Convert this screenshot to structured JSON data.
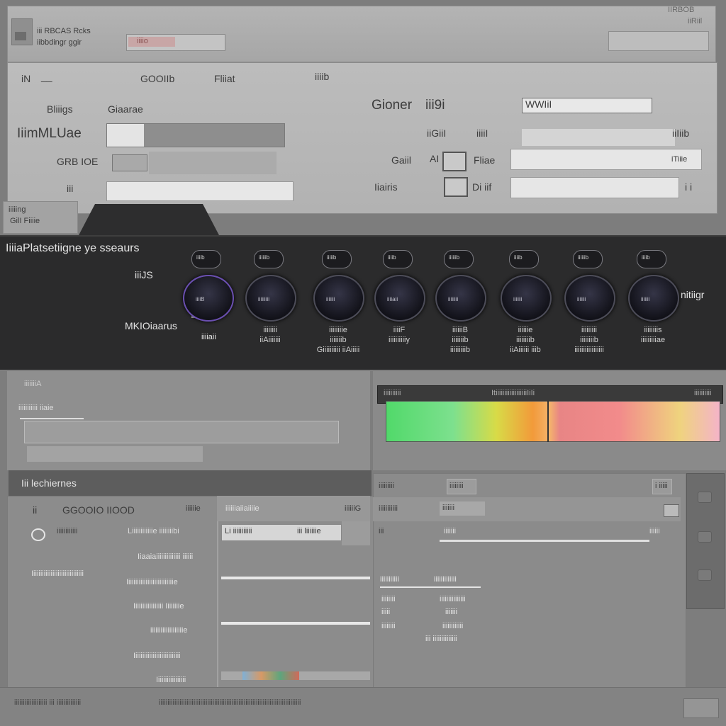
{
  "header": {
    "title_line1": "iii RBCAS Rcks",
    "title_line2": "iibbdingr ggir",
    "field_text": "iiiio",
    "right_title_1": "IIRBOB",
    "right_title_2": "iiRiil"
  },
  "form": {
    "col1_top": "iN",
    "col1_dash": "__",
    "tab_a": "GOOIIb",
    "tab_b": "Fliiat",
    "tab_c": "iiiib",
    "sub_a": "Bliiigs",
    "sub_b": "Giaarae",
    "field1_label": "IiimMLUae",
    "field2_label": "GRB IOE",
    "field3_label": "iii",
    "right_label_1": "Gioner",
    "right_label_1b": "iii9i",
    "right_field_text": "WWIiI",
    "right_row2_a": "iiGiiI",
    "right_row2_b": "iiiiI",
    "right_row2_c": "iiIiib",
    "right_row3_label": "Gaiil",
    "right_row3_mid": "AI",
    "right_row3_c": "Fliae",
    "right_row3_val": "iTiiie",
    "right_row4_label": "Iiairis",
    "right_row4_c": "Di iif",
    "right_row4_val": "i i"
  },
  "corner_tab": {
    "line1": "iiiiing",
    "line2": "GilI Fiiiie"
  },
  "dark": {
    "title": "IiiiaPlatsetiigne ye sseaurs",
    "left_num": "iiiJS",
    "left_label": "MKIOiaarus",
    "left_label_sub": "iiiiaii",
    "right_label": "nitiigr",
    "pills": [
      "iiiib",
      "iiiiiib",
      "iiiiib",
      "iiiib",
      "iiiiiib",
      "iiiib",
      "iiiiiib",
      "iiiib"
    ],
    "dial_caps": [
      "iiiiB",
      "iiiiiiiii",
      "iiiiiii",
      "iiiiaii",
      "iiiiiiii",
      "iiiiiii",
      "iiiiiii",
      "iiiiiii"
    ],
    "labels1": [
      "",
      "iiiiiiii",
      "iiiiiiiie",
      "iiiiF",
      "iiiiiiB",
      "iiiiiie",
      "iiiiiiiii",
      "iiiiiiiis"
    ],
    "labels2": [
      "",
      "iiAiiiiiii",
      "iiiiiiib",
      "iiiiiiiiiiy",
      "iiiiiiib",
      "iiiiiiiib",
      "iiiiiiiib",
      "iiiiiiiiiae"
    ],
    "labels3": [
      "",
      "",
      "Giiiiiiiiii iiAiiiii",
      "",
      "iiiiiiiiib",
      "iiAiiiiii iiib",
      "iiiiiiiiiiiiiiiii",
      ""
    ]
  },
  "lower": {
    "left_title": "iiiiiiiA",
    "left_sub": "iiiiiiiiiii iiaie",
    "right_head_left": "iiiiiiiiii",
    "right_head_mid": "ItiiiiiiiiiiiiiiiiiiIiIi",
    "right_head_right": "iiiiiiiiii"
  },
  "section": {
    "title": "Iii lechiernes"
  },
  "table": {
    "header_a": "GGOOIO IIOOD",
    "header_b": "iiiiiie",
    "header_c": "iiiiiiaiiaiiiie",
    "header_d": "iiiiiiG",
    "row1_a": "iiiiiiiiiiii",
    "row1_b": "Liiiiiiiiiiiie iiiiiiiibi",
    "row1_c": "Li iiiiiiiiiii",
    "row1_d": "iii liiiiiie",
    "left_labels": [
      "Iiiiiiiiiiiiiiiiiiiiiiiiiiiiii"
    ],
    "rows": [
      "Iiaaiaiiiiiiiiiiiiii iiiiii",
      "Iiiiiiiiiiiiiiiiiiiiiiiiiiie",
      "Iiiiiiiiiiiiiiiii Iiiiiiiie",
      "iiiiiiiiiiiiiiiiiiie",
      "Iiiiiiiiiiiiiiiiiiiiiiiiiii",
      "Iiiiiiiiiiiiiiiii"
    ]
  },
  "right_panel": {
    "row1_label": "iiiiiiiii",
    "row1_val": "iiiiiiii",
    "row1_right": "i iiiii",
    "row2_label": "iiiiiiiiiii",
    "row2_val": "iiiiiii",
    "row3_label": "iii",
    "row3_val": "iiiiiii",
    "row3_right": "iiiiii",
    "summary_head_a": "iiiiiiiiiii",
    "summary_head_b": "iiiiiiiiiiiii",
    "summary_rows": [
      [
        "iiiiiiii",
        "iiiiiiiiiiiiiii"
      ],
      [
        "iiiii",
        "iiiiiii"
      ],
      [
        "iiiiiiii",
        "iiiiiiiiiiii"
      ],
      [
        "",
        "iii iiiiiiiiiiiiii"
      ]
    ]
  },
  "footer": {
    "left": "iiiiiiiiiiiiiiiiiii iii iiiiiiiiiiiiii",
    "mid": "iiiiiiiiiiiiiiiiiiiiiiiiiiiiiiiiiiiiiiiiiiiiiiiiiiiiiiiiiiiiiiiiiiiiiiiiiiiiiiiiii"
  }
}
